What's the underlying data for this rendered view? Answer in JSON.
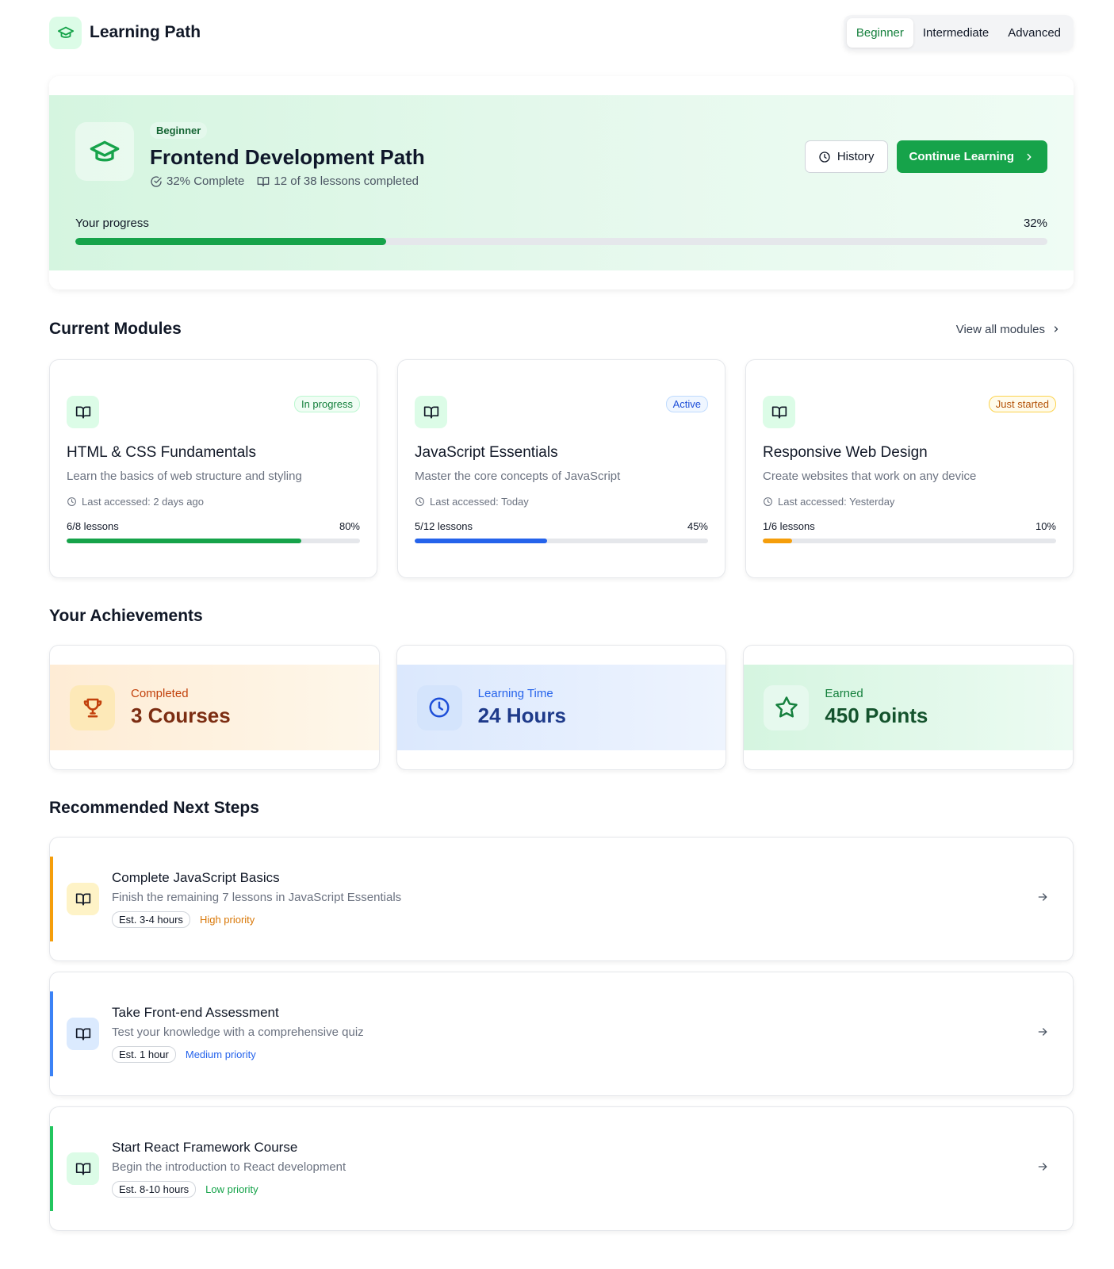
{
  "header": {
    "title": "Learning Path",
    "tabs": [
      {
        "label": "Beginner",
        "active": true
      },
      {
        "label": "Intermediate",
        "active": false
      },
      {
        "label": "Advanced",
        "active": false
      }
    ]
  },
  "hero": {
    "badge": "Beginner",
    "title": "Frontend Development Path",
    "complete_text": "32% Complete",
    "lessons_text": "12 of 38 lessons completed",
    "history_label": "History",
    "continue_label": "Continue Learning",
    "progress_label": "Your progress",
    "progress_text": "32%",
    "progress_value": 0.32
  },
  "modules_section": {
    "title": "Current Modules",
    "view_all": "View all modules",
    "items": [
      {
        "status": "In progress",
        "title": "HTML & CSS Fundamentals",
        "description": "Learn the basics of web structure and styling",
        "last_accessed": "Last accessed: 2 days ago",
        "lessons": "6/8 lessons",
        "percent_text": "80%",
        "progress": 0.8,
        "color": "#16a34a"
      },
      {
        "status": "Active",
        "title": "JavaScript Essentials",
        "description": "Master the core concepts of JavaScript",
        "last_accessed": "Last accessed: Today",
        "lessons": "5/12 lessons",
        "percent_text": "45%",
        "progress": 0.45,
        "color": "#2563eb"
      },
      {
        "status": "Just started",
        "title": "Responsive Web Design",
        "description": "Create websites that work on any device",
        "last_accessed": "Last accessed: Yesterday",
        "lessons": "1/6 lessons",
        "percent_text": "10%",
        "progress": 0.1,
        "color": "#f59e0b"
      }
    ]
  },
  "achievements": {
    "title": "Your Achievements",
    "items": [
      {
        "label": "Completed",
        "value": "3 Courses",
        "icon": "trophy-icon"
      },
      {
        "label": "Learning Time",
        "value": "24 Hours",
        "icon": "clock-icon"
      },
      {
        "label": "Earned",
        "value": "450 Points",
        "icon": "star-icon"
      }
    ]
  },
  "recommendations": {
    "title": "Recommended Next Steps",
    "items": [
      {
        "title": "Complete JavaScript Basics",
        "description": "Finish the remaining 7 lessons in JavaScript Essentials",
        "estimate": "Est. 3-4 hours",
        "priority": "High priority",
        "color": "#f59e0b"
      },
      {
        "title": "Take Front-end Assessment",
        "description": "Test your knowledge with a comprehensive quiz",
        "estimate": "Est. 1 hour",
        "priority": "Medium priority",
        "color": "#3b82f6"
      },
      {
        "title": "Start React Framework Course",
        "description": "Begin the introduction to React development",
        "estimate": "Est. 8-10 hours",
        "priority": "Low priority",
        "color": "#22c55e"
      }
    ]
  }
}
